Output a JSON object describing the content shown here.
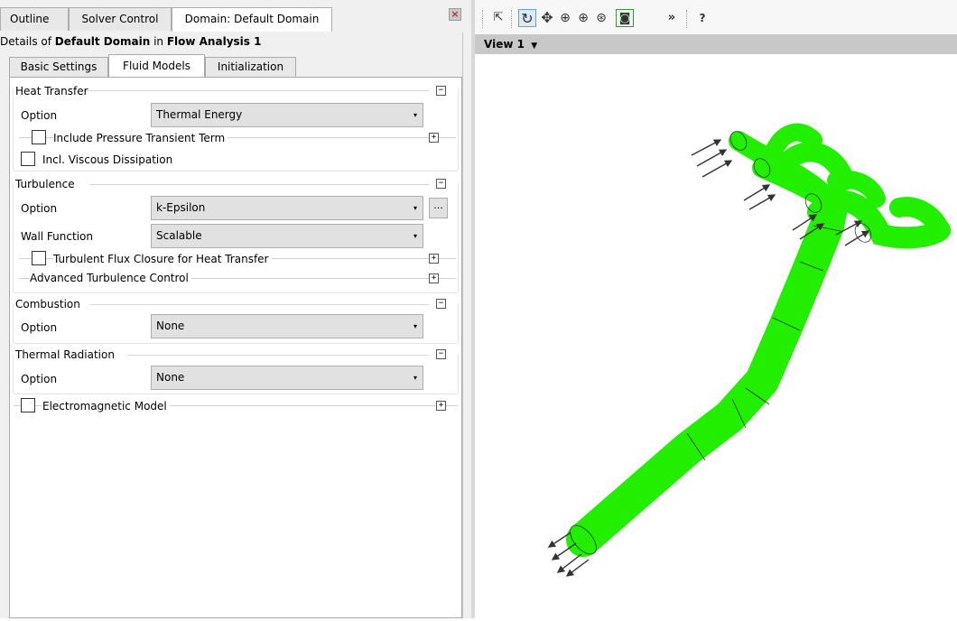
{
  "tabs": {
    "outline": "Outline",
    "solver_control": "Solver Control",
    "domain": "Domain: Default Domain"
  },
  "details": {
    "prefix": "Details of ",
    "domain_name": "Default Domain",
    "middle": " in ",
    "analysis_name": "Flow Analysis 1"
  },
  "subtabs": {
    "basic": "Basic Settings",
    "fluid": "Fluid Models",
    "init": "Initialization"
  },
  "heat_transfer": {
    "title": "Heat Transfer",
    "option_label": "Option",
    "option_value": "Thermal Energy",
    "pressure_transient": "Include Pressure Transient Term",
    "viscous": "Incl. Viscous Dissipation"
  },
  "turbulence": {
    "title": "Turbulence",
    "option_label": "Option",
    "option_value": "k-Epsilon",
    "more_button": "...",
    "wall_label": "Wall Function",
    "wall_value": "Scalable",
    "flux_closure": "Turbulent Flux Closure for Heat Transfer",
    "advanced": "Advanced Turbulence Control"
  },
  "combustion": {
    "title": "Combustion",
    "option_label": "Option",
    "option_value": "None"
  },
  "radiation": {
    "title": "Thermal Radiation",
    "option_label": "Option",
    "option_value": "None"
  },
  "electromagnetic": {
    "label": "Electromagnetic Model"
  },
  "toolbar": {
    "help_glyph": "?",
    "more_glyph": "»"
  },
  "view": {
    "label": "View 1"
  },
  "colors": {
    "model_fill": "#22ee00",
    "view_bar": "#c8c8c8"
  },
  "icons": [
    "select-icon",
    "rotate-icon",
    "pan-icon",
    "zoom-icon",
    "zoom-box-icon",
    "zoom-fit-icon",
    "fit-view-icon",
    "more-icon",
    "help-icon",
    "close-icon",
    "dropdown-arrow-icon",
    "collapse-icon",
    "expand-icon"
  ]
}
